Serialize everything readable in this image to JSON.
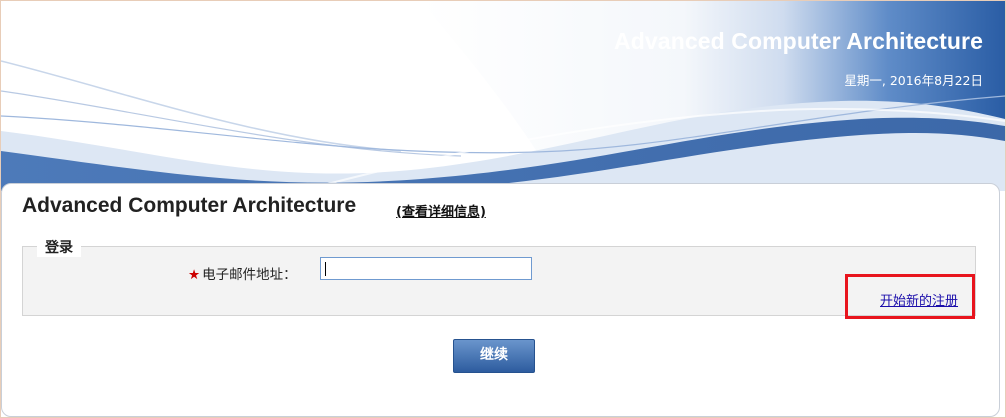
{
  "banner": {
    "title": "Advanced Computer Architecture",
    "date": "星期一, 2016年8月22日"
  },
  "page": {
    "title": "Advanced Computer Architecture",
    "details_link": "(查看详细信息)"
  },
  "login": {
    "legend": "登录",
    "required_mark": "★",
    "email_label": "电子邮件地址：",
    "email_value": "",
    "register_link": "开始新的注册",
    "continue_label": "继续"
  },
  "colors": {
    "banner_blue": "#2a5da5",
    "highlight_red": "#e8141d",
    "button_blue": "#3b6db0"
  }
}
